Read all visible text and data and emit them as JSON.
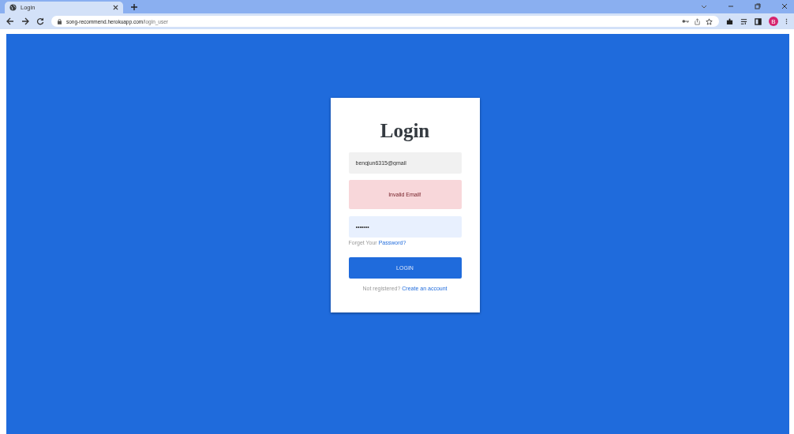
{
  "browser": {
    "tab": {
      "title": "Login",
      "selected": true
    },
    "url": {
      "host": "song-recommend.herokuapp.com",
      "path": "/login_user"
    },
    "profile_initial": "B"
  },
  "login": {
    "title": "Login",
    "email": {
      "value": "bengjun6315@gmail"
    },
    "error": "Invalid Email!",
    "password": {
      "value": "•••••••"
    },
    "forgot": {
      "prefix": "Forget Your ",
      "link": "Password?"
    },
    "button": "LOGIN",
    "register": {
      "prefix": "Not registered? ",
      "link": "Create an account"
    }
  }
}
